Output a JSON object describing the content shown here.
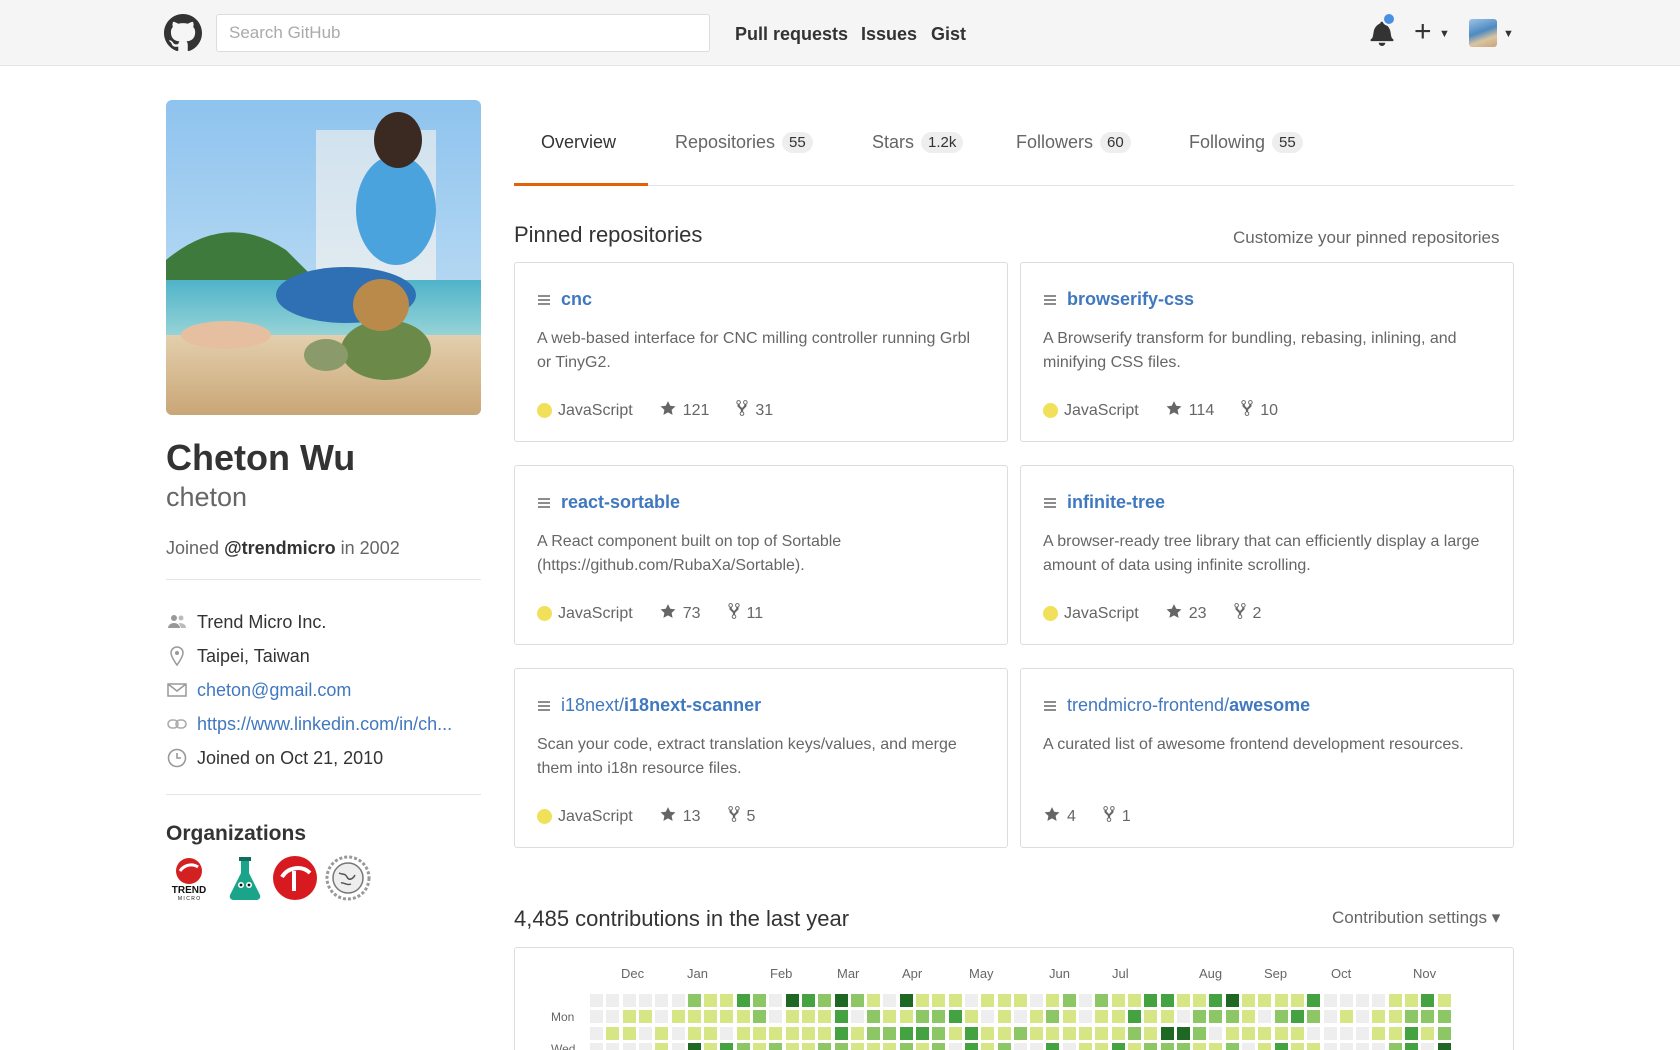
{
  "header": {
    "search_placeholder": "Search GitHub",
    "nav": [
      "Pull requests",
      "Issues",
      "Gist"
    ]
  },
  "profile": {
    "full_name": "Cheton Wu",
    "username": "cheton",
    "joined_prefix": "Joined",
    "joined_org": "@trendmicro",
    "joined_suffix": "in 2002",
    "details": {
      "company": "Trend Micro Inc.",
      "location": "Taipei, Taiwan",
      "email": "cheton@gmail.com",
      "website": "https://www.linkedin.com/in/ch...",
      "joined": "Joined on Oct 21, 2010"
    },
    "organizations_title": "Organizations",
    "organizations": [
      "trend-micro-logo-icon",
      "flask-icon",
      "trend-micro-ball-icon",
      "globe-gear-icon"
    ]
  },
  "tabs": [
    {
      "label": "Overview",
      "count": ""
    },
    {
      "label": "Repositories",
      "count": "55"
    },
    {
      "label": "Stars",
      "count": "1.2k"
    },
    {
      "label": "Followers",
      "count": "60"
    },
    {
      "label": "Following",
      "count": "55"
    }
  ],
  "pinned": {
    "title": "Pinned repositories",
    "customize": "Customize your pinned repositories",
    "repos": [
      {
        "owner": "",
        "name": "cnc",
        "desc": "A web-based interface for CNC milling controller running Grbl or TinyG2.",
        "lang": "JavaScript",
        "stars": "121",
        "forks": "31"
      },
      {
        "owner": "",
        "name": "browserify-css",
        "desc": "A Browserify transform for bundling, rebasing, inlining, and minifying CSS files.",
        "lang": "JavaScript",
        "stars": "114",
        "forks": "10"
      },
      {
        "owner": "",
        "name": "react-sortable",
        "desc": "A React component built on top of Sortable (https://github.com/RubaXa/Sortable).",
        "lang": "JavaScript",
        "stars": "73",
        "forks": "11"
      },
      {
        "owner": "",
        "name": "infinite-tree",
        "desc": "A browser-ready tree library that can efficiently display a large amount of data using infinite scrolling.",
        "lang": "JavaScript",
        "stars": "23",
        "forks": "2"
      },
      {
        "owner": "i18next/",
        "name": "i18next-scanner",
        "desc": "Scan your code, extract translation keys/values, and merge them into i18n resource files.",
        "lang": "JavaScript",
        "stars": "13",
        "forks": "5"
      },
      {
        "owner": "trendmicro-frontend/",
        "name": "awesome",
        "desc": "A curated list of awesome frontend development resources.",
        "lang": "",
        "stars": "4",
        "forks": "1"
      }
    ]
  },
  "contributions": {
    "title": "4,485 contributions in the last year",
    "settings": "Contribution settings ▾",
    "months": [
      "Dec",
      "Jan",
      "Feb",
      "Mar",
      "Apr",
      "May",
      "Jun",
      "Jul",
      "Aug",
      "Sep",
      "Oct",
      "Nov"
    ],
    "weekdays": [
      "Mon",
      "Wed"
    ],
    "colors": [
      "#eeeeee",
      "#d6e685",
      "#8cc665",
      "#44a340",
      "#1e6823"
    ]
  }
}
